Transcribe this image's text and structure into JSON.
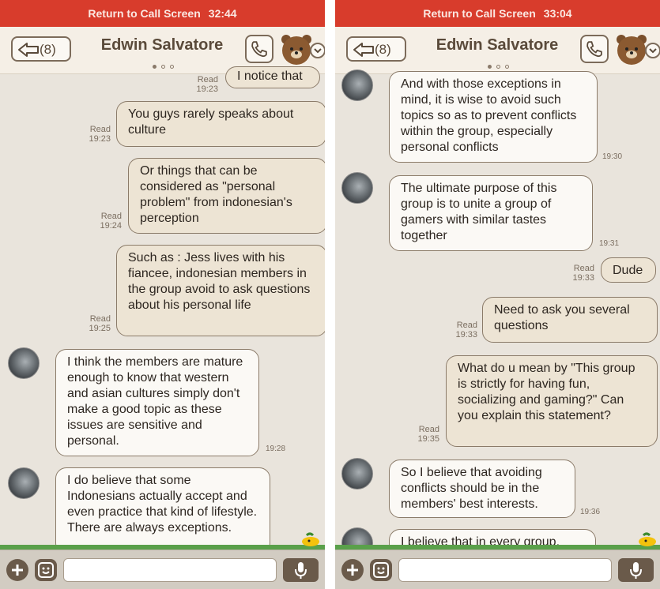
{
  "left": {
    "call_label": "Return to Call Screen",
    "call_time": "32:44",
    "back_count": "(8)",
    "contact": "Edwin Salvatore",
    "messages": [
      {
        "text": "I notice that",
        "read": "Read",
        "time": "19:23"
      },
      {
        "text": "You guys rarely speaks about culture",
        "read": "Read",
        "time": "19:23"
      },
      {
        "text": "Or things that can be considered as \"personal problem\" from indonesian's perception",
        "read": "Read",
        "time": "19:24"
      },
      {
        "text": "Such as : Jess lives with his fiancee, indonesian members in the group avoid to ask questions about his personal life",
        "read": "Read",
        "time": "19:25"
      },
      {
        "text": "I think the members are mature enough to know that western and asian cultures simply don't make a good topic as these issues are sensitive and personal.",
        "time": "19:28"
      },
      {
        "text": "I do believe that some Indonesians actually accept and even practice that kind of lifestyle. There are always exceptions."
      }
    ]
  },
  "right": {
    "call_label": "Return to Call Screen",
    "call_time": "33:04",
    "back_count": "(8)",
    "contact": "Edwin Salvatore",
    "messages": [
      {
        "text": "And with those exceptions in mind, it is wise to avoid such topics so as to prevent conflicts within the group, especially personal conflicts",
        "time": "19:30"
      },
      {
        "text": "The ultimate purpose of this group is to unite a group of gamers with similar tastes together",
        "time": "19:31"
      },
      {
        "text": "Dude",
        "read": "Read",
        "time": "19:33"
      },
      {
        "text": "Need to ask you several questions",
        "read": "Read",
        "time": "19:33"
      },
      {
        "text": "What do u mean by \"This group is strictly for having fun, socializing and gaming?\" Can you explain this statement?",
        "read": "Read",
        "time": "19:35"
      },
      {
        "text": "So I believe that avoiding conflicts should be in the members' best interests.",
        "time": "19:36"
      },
      {
        "text": "I believe that in every group,"
      }
    ]
  },
  "icons": {
    "back": "back-arrow-icon",
    "phone": "phone-icon",
    "avatar": "bear-avatar-icon",
    "menu": "chevron-down-icon",
    "plus": "plus-icon",
    "emoji": "emoji-icon",
    "mic": "microphone-icon"
  },
  "colors": {
    "call_bar": "#d83c2c",
    "background": "#e9e4dc",
    "sent_bubble": "#ede4d4",
    "received_bubble": "#fbf9f5"
  }
}
